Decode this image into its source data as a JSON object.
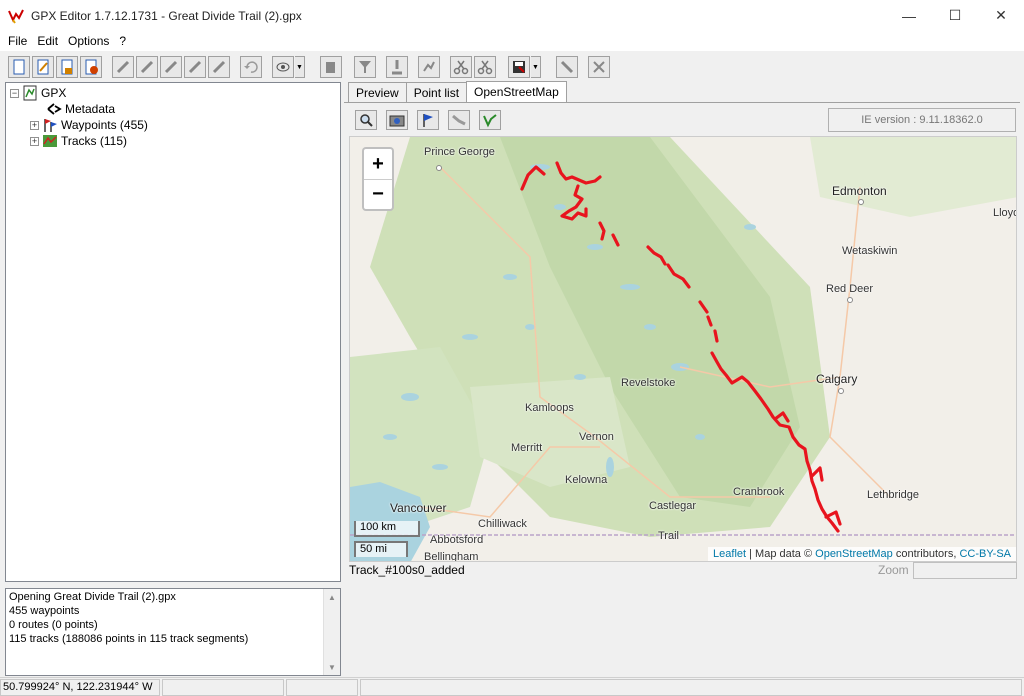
{
  "window": {
    "title": "GPX Editor 1.7.12.1731 - Great Divide Trail (2).gpx",
    "controls": {
      "minimize": "—",
      "maximize": "☐",
      "close": "✕"
    }
  },
  "menu": [
    "File",
    "Edit",
    "Options",
    "?"
  ],
  "tree": {
    "root": "GPX",
    "metadata": "Metadata",
    "waypoints": "Waypoints (455)",
    "tracks": "Tracks (115)"
  },
  "log": [
    "Opening Great Divide Trail (2).gpx",
    "455 waypoints",
    "0 routes (0 points)",
    "115 tracks (188086 points in 115 track segments)"
  ],
  "tabs": [
    "Preview",
    "Point list",
    "OpenStreetMap"
  ],
  "active_tab": "OpenStreetMap",
  "ie_version": "IE version : 9.11.18362.0",
  "map": {
    "zoom_in": "+",
    "zoom_out": "−",
    "places": [
      "Prince George",
      "Edmonton",
      "Lloyd",
      "Wetaskiwin",
      "Red Deer",
      "Calgary",
      "Revelstoke",
      "Kamloops",
      "Vernon",
      "Merritt",
      "Kelowna",
      "Cranbrook",
      "Lethbridge",
      "Castlegar",
      "Trail",
      "Vancouver",
      "Chilliwack",
      "Abbotsford",
      "Bellingham"
    ],
    "scale_km": "100 km",
    "scale_mi": "50 mi",
    "attribution": {
      "leaflet": "Leaflet",
      "sep": " | Map data © ",
      "osm": "OpenStreetMap",
      "contributors": " contributors, ",
      "license": "CC-BY-SA"
    },
    "track_color": "#e8141e"
  },
  "status": {
    "track": "Track_#100s0_added",
    "zoom_label": "Zoom",
    "coords": "50.799924° N, 122.231944° W"
  }
}
